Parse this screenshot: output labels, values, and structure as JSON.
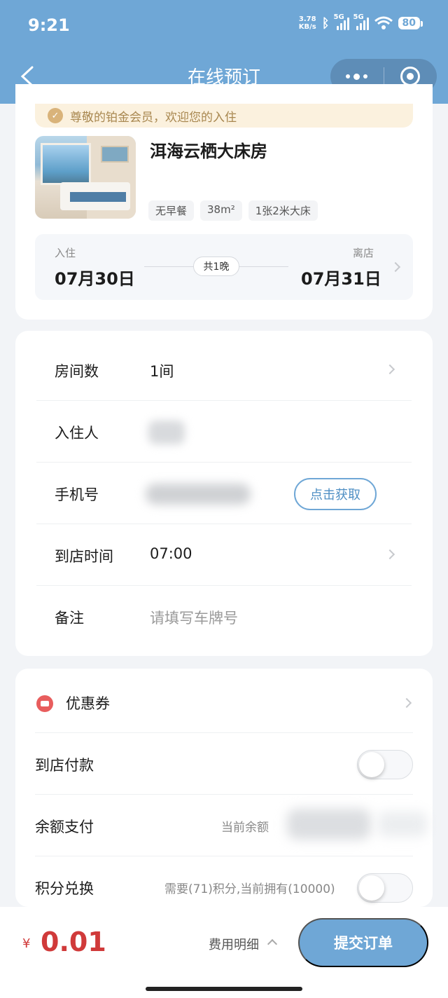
{
  "status_bar": {
    "time": "9:21",
    "net_speed": "3.78",
    "net_unit": "KB/s",
    "sig1_label": "5G",
    "sig2_label": "5G",
    "battery": "80"
  },
  "nav": {
    "title": "在线预订"
  },
  "member_banner": "尊敬的铂金会员，欢迎您的入住",
  "room": {
    "name": "洱海云栖大床房",
    "tags": [
      "无早餐",
      "38m²",
      "1张2米大床"
    ]
  },
  "stay": {
    "checkin_label": "入住",
    "checkin_date": "07月30日",
    "checkout_label": "离店",
    "checkout_date": "07月31日",
    "nights": "共1晚"
  },
  "form": {
    "rooms_label": "房间数",
    "rooms_value": "1间",
    "guest_label": "入住人",
    "phone_label": "手机号",
    "phone_button": "点击获取",
    "arrival_label": "到店时间",
    "arrival_value": "07:00",
    "remark_label": "备注",
    "remark_placeholder": "请填写车牌号"
  },
  "payment": {
    "coupon_label": "优惠券",
    "pay_at_hotel_label": "到店付款",
    "pay_at_hotel_on": false,
    "balance_label": "余额支付",
    "balance_hint": "当前余额",
    "points_label": "积分兑换",
    "points_hint": "需要(71)积分,当前拥有(10000)",
    "points_on": false
  },
  "bottom": {
    "currency": "¥",
    "total": "0.01",
    "detail_label": "费用明细",
    "submit_label": "提交订单"
  },
  "colors": {
    "accent": "#6fa7d6",
    "price": "#d03a3a",
    "gold": "#a8874f"
  }
}
